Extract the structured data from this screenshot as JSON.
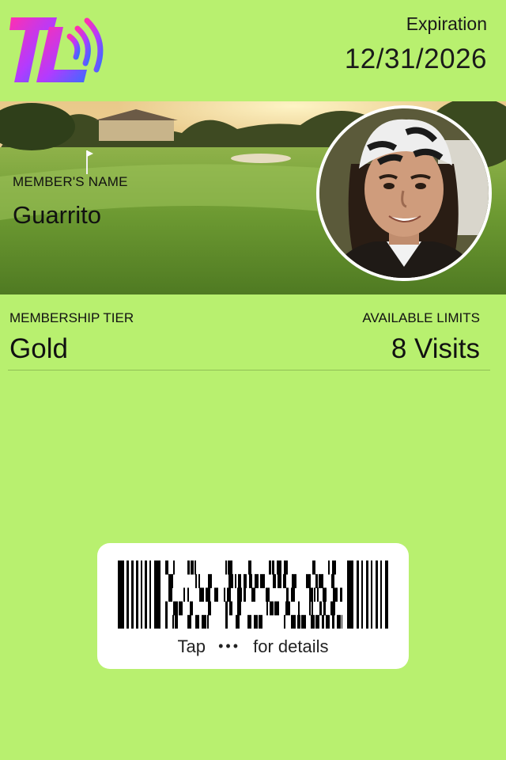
{
  "header": {
    "logo_text": "TL",
    "expiration_label": "Expiration",
    "expiration_value": "12/31/2026"
  },
  "member": {
    "name_label": "MEMBER'S NAME",
    "name_value": "Guarrito"
  },
  "details": {
    "tier_label": "MEMBERSHIP TIER",
    "tier_value": "Gold",
    "limits_label": "AVAILABLE LIMITS",
    "limits_value": "8 Visits"
  },
  "barcode": {
    "tap_prefix": "Tap",
    "tap_icon": "more-dots-icon",
    "tap_suffix": "for details"
  },
  "colors": {
    "background": "#b8f06f",
    "logo_gradient_start": "#ff2fb0",
    "logo_gradient_end": "#3b6bff"
  }
}
